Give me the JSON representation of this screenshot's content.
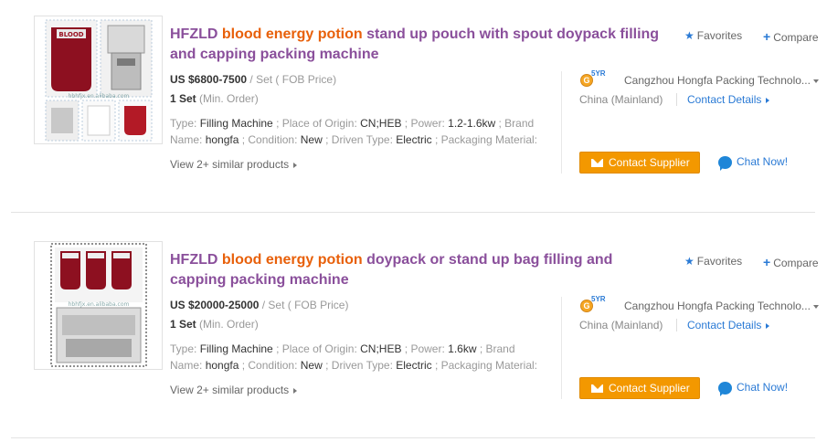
{
  "listings": [
    {
      "title_prefix": "HFZLD ",
      "title_keyword": "blood energy potion",
      "title_suffix": " stand up pouch with spout doypack filling and capping packing machine",
      "price": "US $6800-7500",
      "price_unit": " / Set ( FOB Price)",
      "moq": "1 Set",
      "moq_unit": " (Min. Order)",
      "attr_type_label": "Type: ",
      "attr_type": "Filling Machine",
      "attr_origin_label": " ; Place of Origin: ",
      "attr_origin": "CN;HEB",
      "attr_power_label": " ; Power: ",
      "attr_power": "1.2-1.6kw",
      "attr_brand_label": " ; Brand Name: ",
      "attr_brand": "hongfa",
      "attr_condition_label": " ; Condition: ",
      "attr_condition": "New",
      "attr_driven_label": " ; Driven Type: ",
      "attr_driven": "Electric",
      "attr_pack_label": " ; Packaging Material:",
      "similar": "View 2+ similar products",
      "favorites": "Favorites",
      "compare": "Compare",
      "gold_years": "5YR",
      "gold_coin": "G",
      "supplier": "Cangzhou Hongfa Packing Technolo...",
      "country": "China (Mainland)",
      "contact_details": "Contact Details",
      "contact_supplier": "Contact Supplier",
      "chat": "Chat Now!",
      "thumb_watermark": "hbhfjx.en.alibaba.com"
    },
    {
      "title_prefix": "HFZLD ",
      "title_keyword": "blood energy potion",
      "title_suffix": " doypack or stand up bag filling and capping packing machine",
      "price": "US $20000-25000",
      "price_unit": " / Set ( FOB Price)",
      "moq": "1 Set",
      "moq_unit": " (Min. Order)",
      "attr_type_label": "Type: ",
      "attr_type": "Filling Machine",
      "attr_origin_label": " ; Place of Origin: ",
      "attr_origin": "CN;HEB",
      "attr_power_label": " ; Power: ",
      "attr_power": "1.6kw",
      "attr_brand_label": " ; Brand Name: ",
      "attr_brand": "hongfa",
      "attr_condition_label": " ; Condition: ",
      "attr_condition": "New",
      "attr_driven_label": " ; Driven Type: ",
      "attr_driven": "Electric",
      "attr_pack_label": " ; Packaging Material:",
      "similar": "View 2+ similar products",
      "favorites": "Favorites",
      "compare": "Compare",
      "gold_years": "5YR",
      "gold_coin": "G",
      "supplier": "Cangzhou Hongfa Packing Technolo...",
      "country": "China (Mainland)",
      "contact_details": "Contact Details",
      "contact_supplier": "Contact Supplier",
      "chat": "Chat Now!",
      "thumb_watermark": "hbhfjx.en.alibaba.com"
    }
  ],
  "colors": {
    "title": "#8a4f9b",
    "keyword": "#e8600a",
    "link": "#2a7ad5",
    "button": "#f39800"
  },
  "icons": [
    "star-icon",
    "plus-icon",
    "gold-supplier-icon",
    "dropdown-caret-icon",
    "chevron-right-icon",
    "mail-icon",
    "chat-bubble-icon"
  ]
}
